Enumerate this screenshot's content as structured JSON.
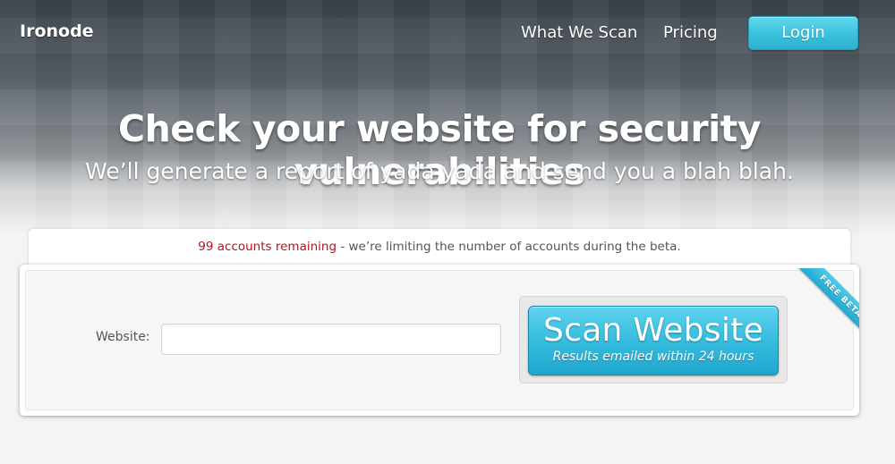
{
  "header": {
    "logo": "Ironode",
    "nav": {
      "what_we_scan": "What We Scan",
      "pricing": "Pricing",
      "login": "Login"
    }
  },
  "hero": {
    "headline": "Check your website for security vulnerabilities",
    "subheadline": "We’ll generate a report of yada yada and send you a blah blah."
  },
  "notice": {
    "count_text": "99 accounts remaining",
    "rest_text": " - we’re limiting the number of accounts during the beta."
  },
  "form": {
    "website_label": "Website:",
    "website_value": "",
    "website_placeholder": "",
    "scan_button_title": "Scan Website",
    "scan_button_subtitle": "Results emailed within 24 hours",
    "ribbon": "FREE BETA"
  },
  "colors": {
    "accent": "#39bfe0",
    "notice_count": "#b5121b"
  }
}
